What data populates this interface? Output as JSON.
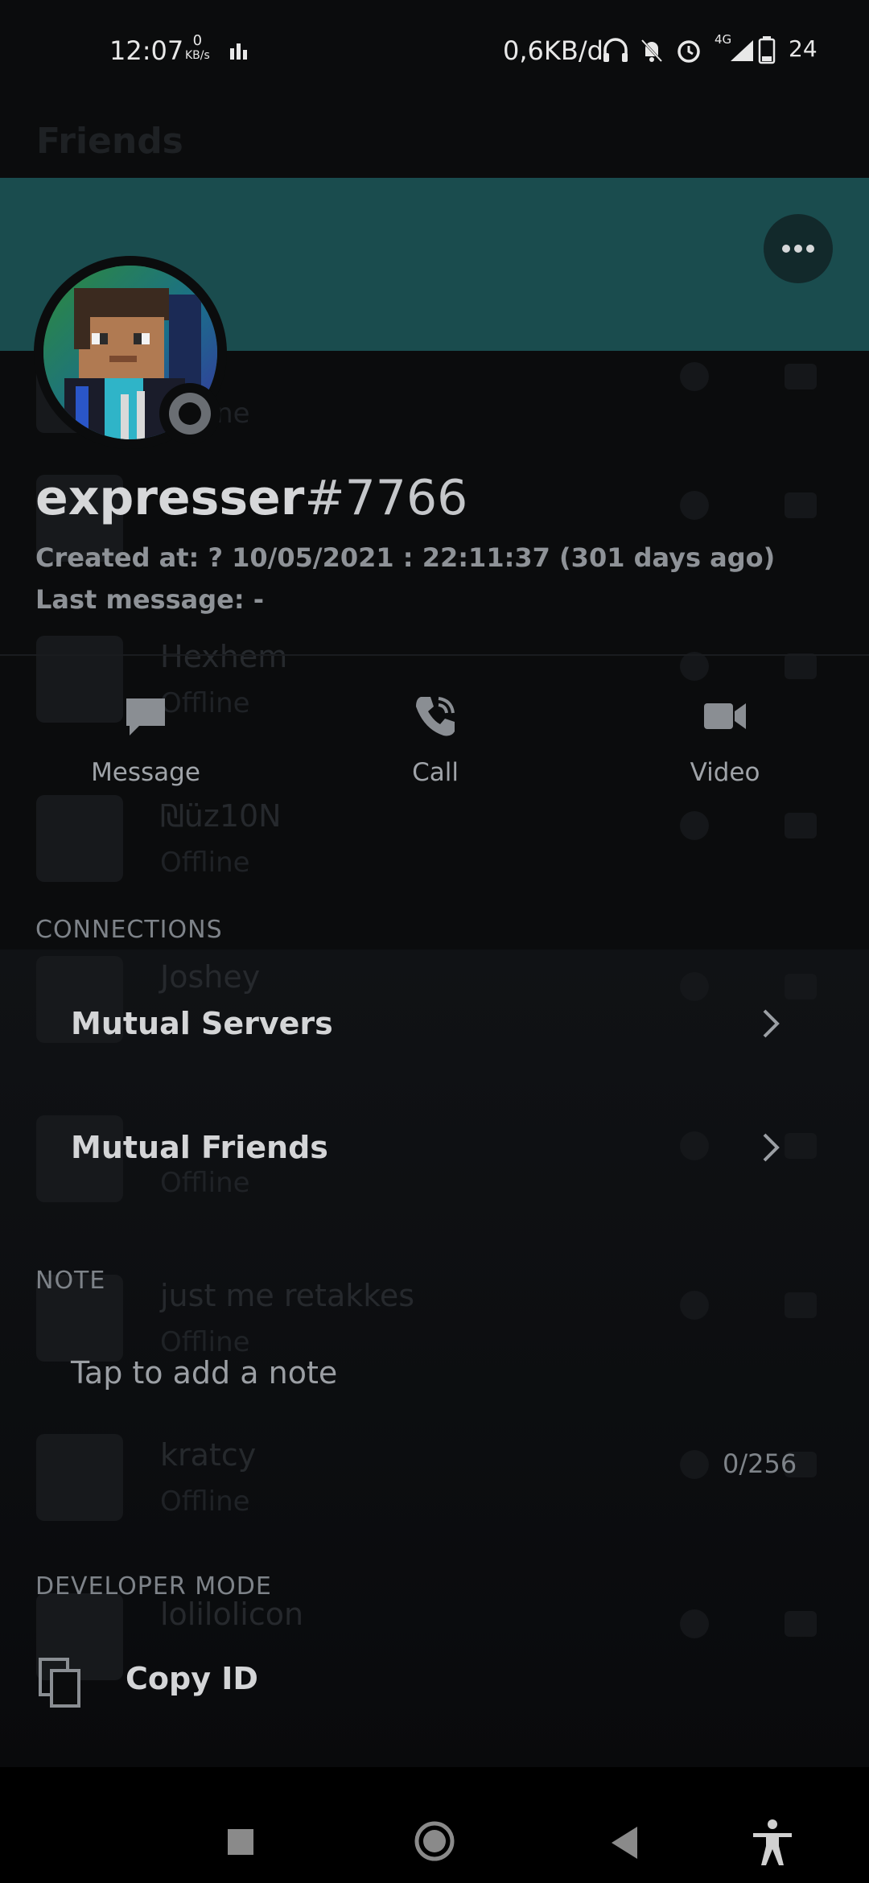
{
  "status_bar": {
    "time": "12:07",
    "speed_value": "0",
    "speed_unit": "KB/s",
    "network": "0,6KB/d",
    "network_type": "4G",
    "battery": "24"
  },
  "background": {
    "title": "Friends",
    "friends": [
      {
        "name": "",
        "status": "Offline"
      },
      {
        "name": "",
        "status": ""
      },
      {
        "name": "Hexhem",
        "status": "Offline"
      },
      {
        "name": "₪üz10N",
        "status": "Offline"
      },
      {
        "name": "Joshey",
        "status": ""
      },
      {
        "name": "",
        "status": "Offline"
      },
      {
        "name": "just me retakkes",
        "status": "Offline"
      },
      {
        "name": "kratcy",
        "status": "Offline"
      },
      {
        "name": "lolilolicon",
        "status": ""
      }
    ]
  },
  "profile": {
    "username": "expresser",
    "discriminator": "#7766",
    "created_at": "Created at: ? 10/05/2021 : 22:11:37 (301 days ago)",
    "last_message": "Last message: -",
    "banner_color": "#1a4c4e",
    "status_color": "#6a6e73"
  },
  "actions": [
    {
      "label": "Message",
      "icon": "chat-bubble-icon"
    },
    {
      "label": "Call",
      "icon": "phone-icon"
    },
    {
      "label": "Video",
      "icon": "video-camera-icon"
    }
  ],
  "connections": {
    "title": "CONNECTIONS",
    "items": [
      {
        "label": "Mutual Servers"
      },
      {
        "label": "Mutual Friends"
      }
    ]
  },
  "note": {
    "title": "NOTE",
    "placeholder": "Tap to add a note",
    "counter": "0/256"
  },
  "developer": {
    "title": "DEVELOPER MODE",
    "copy_id_label": "Copy ID"
  }
}
